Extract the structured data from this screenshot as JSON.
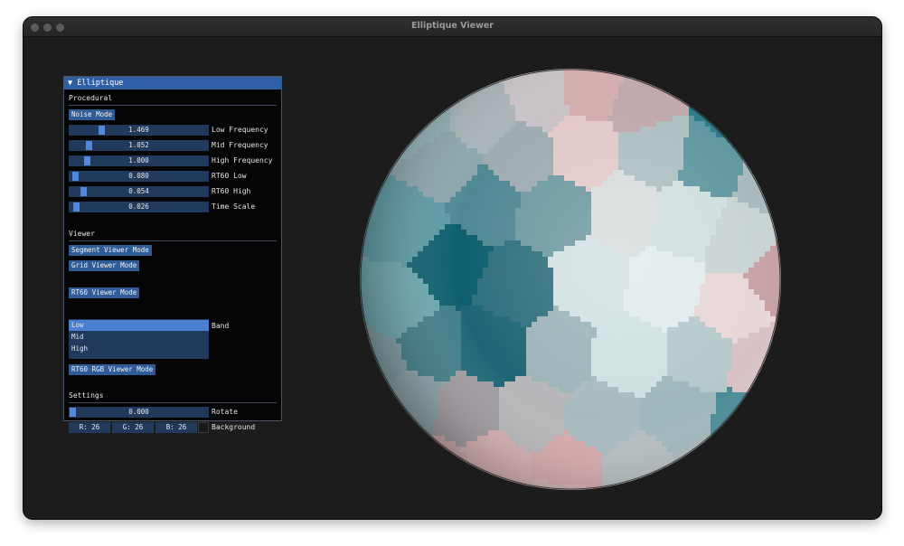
{
  "window": {
    "title": "Elliptique Viewer"
  },
  "panel": {
    "title": "Elliptique",
    "procedural": {
      "heading": "Procedural",
      "noise_mode_label": "Noise Mode",
      "sliders": [
        {
          "label": "Low Frequency",
          "display": "1.469",
          "fraction": 0.22
        },
        {
          "label": "Mid Frequency",
          "display": "1.052",
          "fraction": 0.12
        },
        {
          "label": "High Frequency",
          "display": "1.000",
          "fraction": 0.11
        },
        {
          "label": "RT60 Low",
          "display": "0.080",
          "fraction": 0.02
        },
        {
          "label": "RT60 High",
          "display": "0.054",
          "fraction": 0.08
        },
        {
          "label": "Time Scale",
          "display": "0.026",
          "fraction": 0.03
        }
      ]
    },
    "viewer": {
      "heading": "Viewer",
      "segment_mode_label": "Segment Viewer Mode",
      "grid_mode_label": "Grid Viewer Mode",
      "rt60_mode_label": "RT60 Viewer Mode",
      "band_label": "Band",
      "band_options": [
        "Low",
        "Mid",
        "High"
      ],
      "band_selected": "Low",
      "rt60_rgb_mode_label": "RT60 RGB Viewer Mode"
    },
    "settings": {
      "heading": "Settings",
      "rotate": {
        "label": "Rotate",
        "display": "0.000",
        "fraction": 0.0
      },
      "background_label": "Background",
      "r_label": "R: 26",
      "g_label": "G: 26",
      "b_label": "B: 26",
      "background_color": "#1a1a1a"
    }
  },
  "colors": {
    "accent": "#2f5fa6",
    "button": "#2f5c96",
    "frame_bg": "#213a5c",
    "sphere_dark_teal": "#0e5f6e",
    "sphere_light": "#dfe8e8",
    "sphere_pink": "#d9a7a7"
  }
}
